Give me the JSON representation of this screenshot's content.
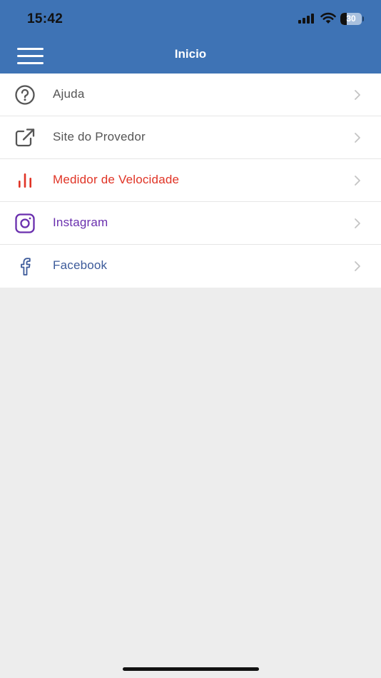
{
  "status_bar": {
    "time": "15:42",
    "battery_level": "30",
    "battery_fraction": 0.3
  },
  "header": {
    "title": "Inicio",
    "menu_icon": "hamburger-menu-icon"
  },
  "menu": {
    "items": [
      {
        "label": "Ajuda",
        "icon": "help-circle-icon",
        "color": "#555555"
      },
      {
        "label": "Site do Provedor",
        "icon": "external-link-icon",
        "color": "#555555"
      },
      {
        "label": "Medidor de Velocidade",
        "icon": "speed-bars-icon",
        "color": "#e03325"
      },
      {
        "label": "Instagram",
        "icon": "instagram-icon",
        "color": "#6a2fae"
      },
      {
        "label": "Facebook",
        "icon": "facebook-icon",
        "color": "#3c5a9a"
      }
    ]
  },
  "colors": {
    "accent": "#3e73b5",
    "background": "#ededed",
    "chevron": "#c4c4c4"
  }
}
